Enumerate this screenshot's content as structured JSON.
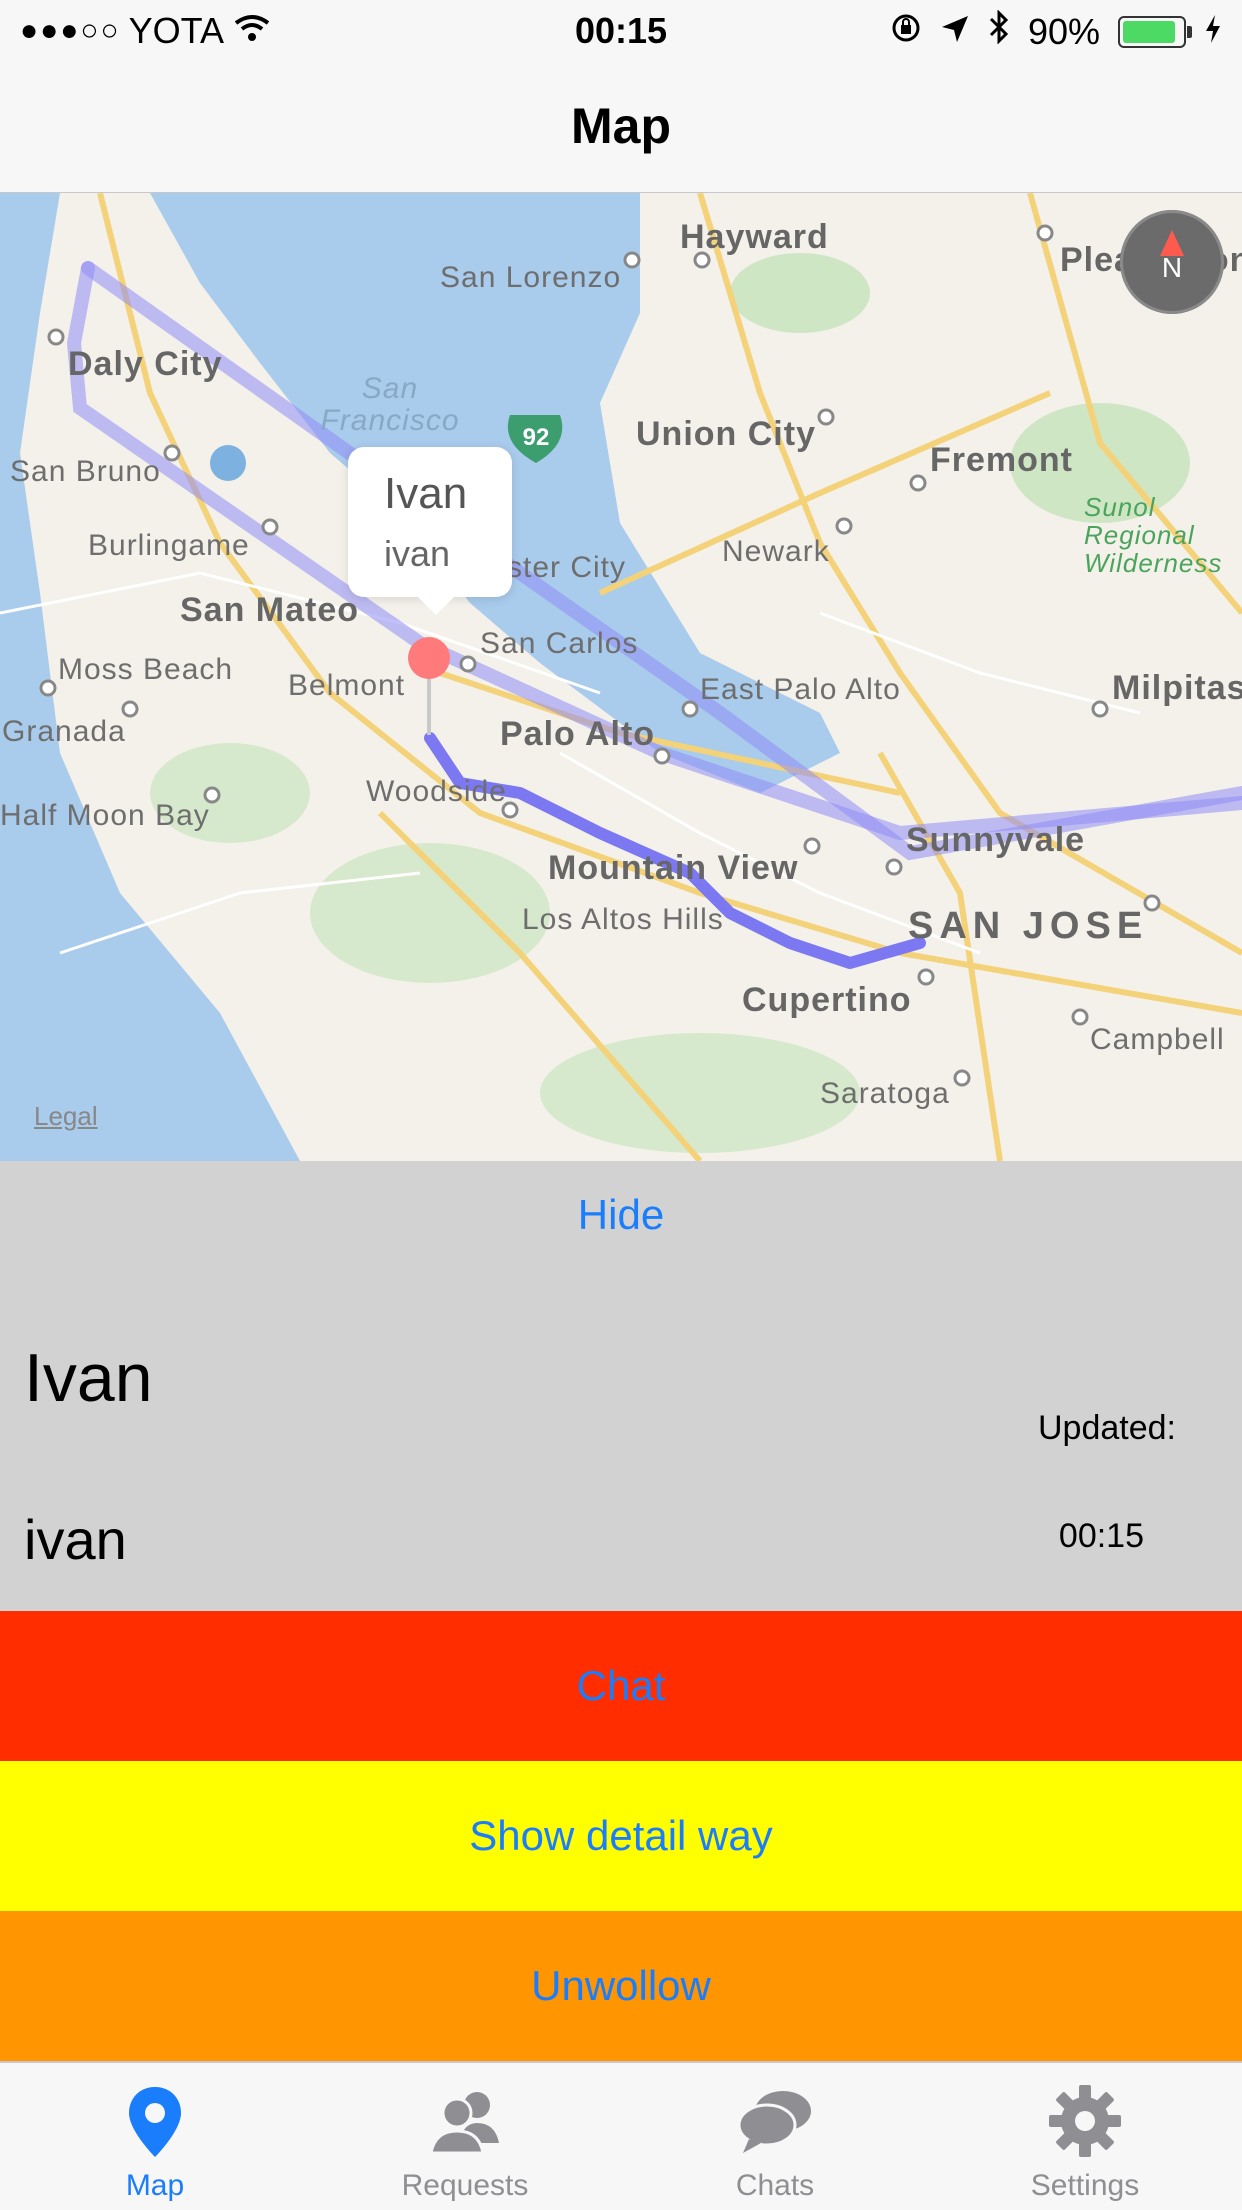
{
  "status_bar": {
    "carrier": "YOTA",
    "signal": "●●●○○",
    "time": "00:15",
    "battery": "90%"
  },
  "nav": {
    "title": "Map"
  },
  "map": {
    "legal": "Legal",
    "compass_label": "N",
    "places": [
      "Hayward",
      "San Lorenzo",
      "Pleasanton",
      "Daly City",
      "San Francisco",
      "Union City",
      "Fremont",
      "Sunol Regional Wilderness",
      "San Bruno",
      "Burlingame",
      "Foster City",
      "Newark",
      "San Mateo",
      "San Carlos",
      "Moss Beach",
      "Belmont",
      "East Palo Alto",
      "Milpitas",
      "Granada",
      "Palo Alto",
      "Woodside",
      "Half Moon Bay",
      "Sunnyvale",
      "Mountain View",
      "Los Altos Hills",
      "SAN JOSE",
      "Cupertino",
      "Campbell",
      "Saratoga"
    ],
    "highway": "92",
    "callout": {
      "title": "Ivan",
      "subtitle": "ivan"
    }
  },
  "panel": {
    "hide_label": "Hide",
    "name": "Ivan",
    "username": "ivan",
    "updated_label": "Updated:",
    "updated_time": "00:15"
  },
  "actions": {
    "chat": "Chat",
    "detail": "Show detail way",
    "unfollow": "Unwollow"
  },
  "tabs": [
    {
      "label": "Map",
      "icon": "map-pin-icon",
      "active": true
    },
    {
      "label": "Requests",
      "icon": "people-icon",
      "active": false
    },
    {
      "label": "Chats",
      "icon": "chat-bubbles-icon",
      "active": false
    },
    {
      "label": "Settings",
      "icon": "gear-icon",
      "active": false
    }
  ],
  "colors": {
    "accent": "#1a7dfb",
    "chat_bg": "#ff2d00",
    "detail_bg": "#ffff00",
    "unfollow_bg": "#ff9500",
    "panel_bg": "#d2d2d2",
    "route": "#8f8cf7"
  }
}
